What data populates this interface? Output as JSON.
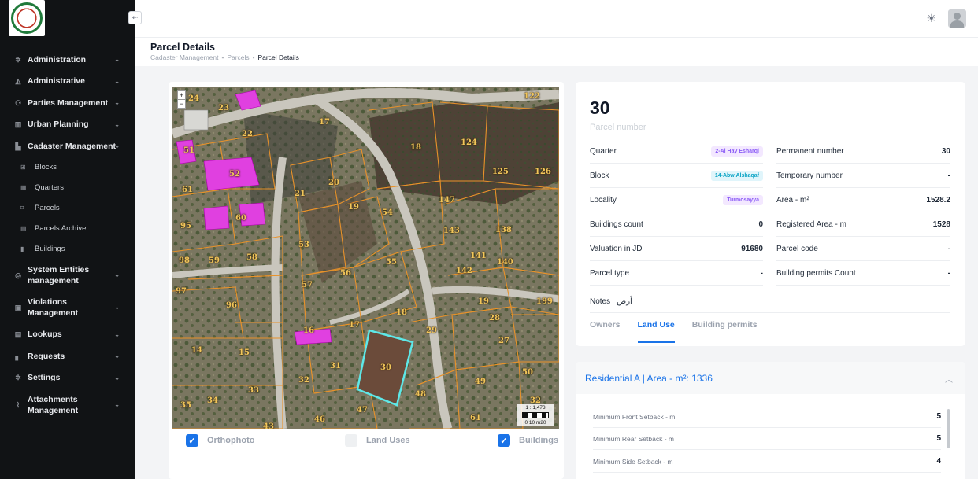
{
  "sidebar": {
    "items": [
      {
        "label": "Administration",
        "icon": "gear-icon"
      },
      {
        "label": "Administrative",
        "icon": "map-area-icon"
      },
      {
        "label": "Parties Management",
        "icon": "users-icon"
      },
      {
        "label": "Urban Planning",
        "icon": "map-icon"
      },
      {
        "label": "Cadaster Management",
        "icon": "building-icon"
      }
    ],
    "sub_items": [
      {
        "label": "Blocks",
        "icon": "grid-icon"
      },
      {
        "label": "Quarters",
        "icon": "grid-icon"
      },
      {
        "label": "Parcels",
        "icon": "square-icon"
      },
      {
        "label": "Parcels Archive",
        "icon": "archive-icon"
      },
      {
        "label": "Buildings",
        "icon": "building-icon"
      }
    ],
    "items_after": [
      {
        "label": "System Entities management",
        "icon": "gear-icon"
      },
      {
        "label": "Violations Management",
        "icon": "alert-icon"
      },
      {
        "label": "Lookups",
        "icon": "list-icon"
      },
      {
        "label": "Requests",
        "icon": "file-icon"
      },
      {
        "label": "Settings",
        "icon": "gear-icon"
      },
      {
        "label": "Attachments Management",
        "icon": "paperclip-icon"
      }
    ]
  },
  "header": {
    "title": "Parcel Details",
    "breadcrumb": [
      "Cadaster Management",
      "Parcels",
      "Parcel Details"
    ]
  },
  "map": {
    "zoom_in": "+",
    "zoom_out": "−",
    "scale_label": "1 : 1,473",
    "scale_ticks": "0  10 m20",
    "parcel_labels": [
      "24",
      "23",
      "22",
      "17",
      "18",
      "124",
      "122",
      "125",
      "126",
      "51",
      "52",
      "61",
      "21",
      "20",
      "19",
      "54",
      "147",
      "143",
      "138",
      "95",
      "60",
      "53",
      "55",
      "141",
      "140",
      "98",
      "59",
      "58",
      "56",
      "142",
      "97",
      "57",
      "19",
      "199",
      "96",
      "18",
      "28",
      "16",
      "17",
      "29",
      "27",
      "14",
      "15",
      "31",
      "30",
      "50",
      "32",
      "49",
      "33",
      "48",
      "35",
      "34",
      "47",
      "46",
      "43",
      "61",
      "32"
    ],
    "layers": [
      {
        "label": "Orthophoto",
        "checked": true
      },
      {
        "label": "Land Uses",
        "checked": false
      },
      {
        "label": "Buildings",
        "checked": true
      }
    ]
  },
  "parcel": {
    "number": "30",
    "number_label": "Parcel number",
    "left": [
      {
        "label": "Quarter",
        "value": "2-Al Hay Esharqi",
        "style": "purple"
      },
      {
        "label": "Block",
        "value": "14-Abw Alshaqaf",
        "style": "cyan"
      },
      {
        "label": "Locality",
        "value": "Turmosayya",
        "style": "purple"
      },
      {
        "label": "Buildings count",
        "value": "0"
      },
      {
        "label": "Valuation in JD",
        "value": "91680"
      },
      {
        "label": "Parcel type",
        "value": "-"
      }
    ],
    "right": [
      {
        "label": "Permanent number",
        "value": "30"
      },
      {
        "label": "Temporary number",
        "value": "-"
      },
      {
        "label": "Area - m²",
        "value": "1528.2"
      },
      {
        "label": "Registered Area - m",
        "value": "1528"
      },
      {
        "label": "Parcel code",
        "value": "-"
      },
      {
        "label": "Building permits Count",
        "value": "-"
      }
    ],
    "notes_label": "Notes",
    "notes_value": "أرض",
    "tabs": [
      "Owners",
      "Land Use",
      "Building permits"
    ],
    "active_tab": "Land Use"
  },
  "land_use": {
    "title": "Residential A | Area - m²: 1336",
    "rows": [
      {
        "label": "Minimum Front Setback - m",
        "value": "5"
      },
      {
        "label": "Minimum Rear Setback - m",
        "value": "5"
      },
      {
        "label": "Minimum Side Setback - m",
        "value": "4"
      }
    ]
  },
  "colors": {
    "accent": "#1a73e8",
    "sidebar_bg": "#111315",
    "parcel_outline": "#e8922a",
    "selected_parcel": "#5ee8e8",
    "building_fill": "#e040e0"
  }
}
